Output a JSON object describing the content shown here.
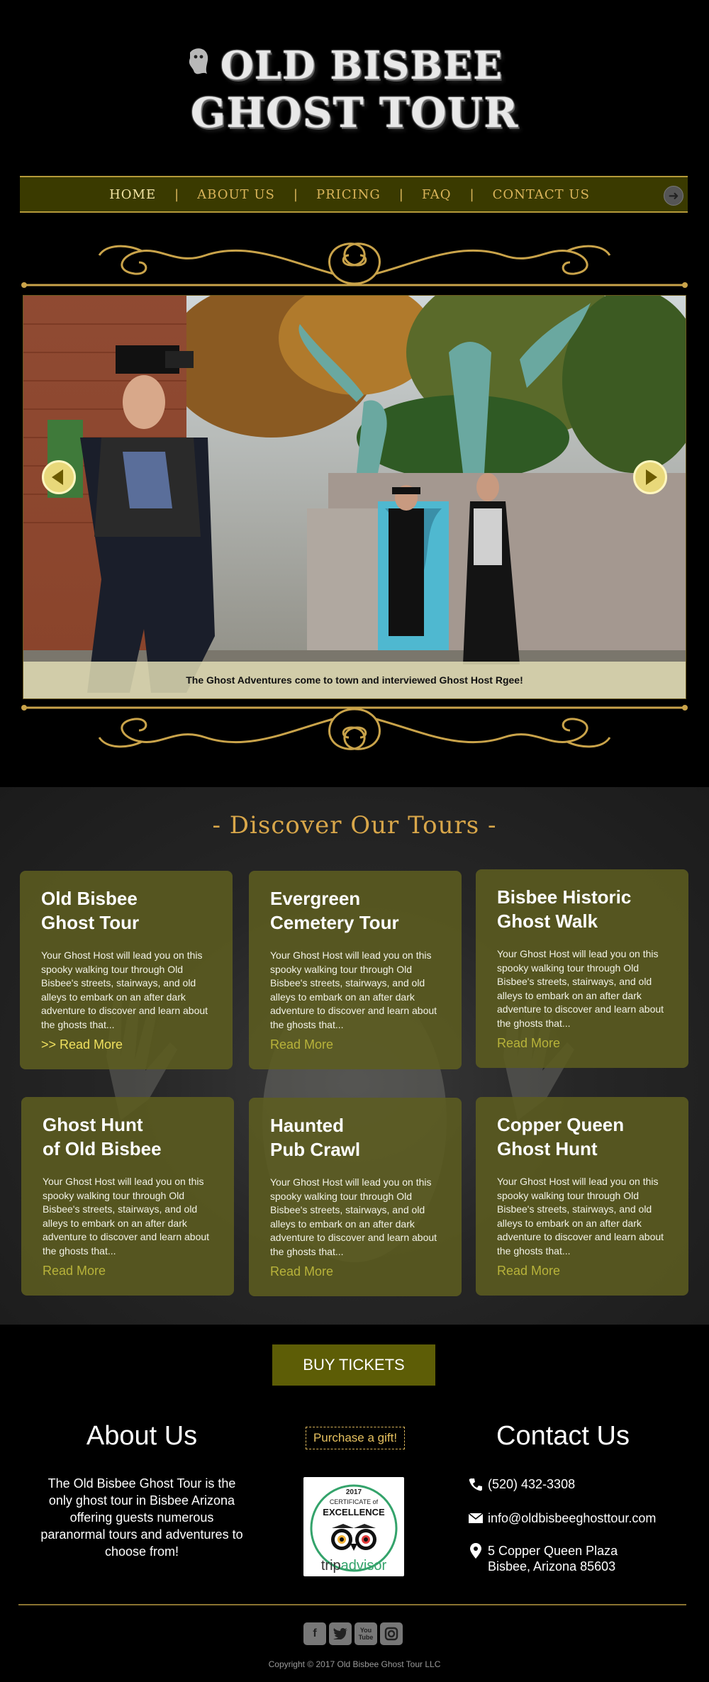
{
  "header": {
    "logo_line1": "OLD BISBEE",
    "logo_line2": "GHOST TOUR"
  },
  "nav": {
    "items": [
      {
        "label": "HOME",
        "active": true
      },
      {
        "label": "ABOUT US"
      },
      {
        "label": "PRICING"
      },
      {
        "label": "FAQ"
      },
      {
        "label": "CONTACT US"
      }
    ],
    "separator": "|"
  },
  "slider": {
    "caption": "The Ghost Adventures come to town and interviewed Ghost Host Rgee!"
  },
  "tours": {
    "title": "- Discover Our Tours -",
    "cards": [
      {
        "title": "Old Bisbee\nGhost Tour",
        "description": "Your Ghost Host will lead you on this spooky walking tour through Old Bisbee's streets, stairways, and old alleys to embark on an after dark adventure to discover and learn about the ghosts that...",
        "more": ">> Read More"
      },
      {
        "title": "Evergreen\nCemetery Tour",
        "description": "Your Ghost Host will lead you on this spooky walking tour through Old Bisbee's streets, stairways, and old alleys to embark on an after dark adventure to discover and learn about the ghosts that...",
        "more": "Read More"
      },
      {
        "title": "Bisbee Historic\nGhost Walk",
        "description": "Your Ghost Host will lead you on this spooky walking tour through Old Bisbee's streets, stairways, and old alleys to embark on an after dark adventure to discover and learn about the ghosts that...",
        "more": "Read More"
      },
      {
        "title": "Ghost Hunt\nof Old Bisbee",
        "description": "Your Ghost Host will lead you on this spooky walking tour through Old Bisbee's streets, stairways, and old alleys to embark on an after dark adventure to discover and learn about the ghosts that...",
        "more": "Read More"
      },
      {
        "title": "Haunted\nPub Crawl",
        "description": "Your Ghost Host will lead you on this spooky walking tour through Old Bisbee's streets, stairways, and old alleys to embark on an after dark adventure to discover and learn about the ghosts that...",
        "more": "Read More"
      },
      {
        "title": "Copper Queen\nGhost Hunt",
        "description": "Your Ghost Host will lead you on this spooky walking tour through Old Bisbee's streets, stairways, and old alleys to embark on an after dark adventure to discover and learn about the ghosts that...",
        "more": "Read More"
      }
    ]
  },
  "buy_tickets": "BUY TICKETS",
  "about": {
    "heading": "About Us",
    "text": "The Old Bisbee Ghost Tour is  the only ghost tour in Bisbee Arizona offering guests numerous paranormal tours and adventures to choose from!"
  },
  "gift": "Purchase a gift!",
  "tripadvisor": {
    "year": "2017",
    "line1": "CERTIFICATE of",
    "line2": "EXCELLENCE",
    "brand_a": "trip",
    "brand_b": "advisor"
  },
  "contact": {
    "heading": "Contact Us",
    "phone": "(520) 432-3308",
    "email": "info@oldbisbeeghosttour.com",
    "address_line1": "5 Copper Queen Plaza",
    "address_line2": "Bisbee, Arizona 85603"
  },
  "social": [
    "facebook-icon",
    "twitter-icon",
    "youtube-icon",
    "instagram-icon"
  ],
  "copyright": "Copyright © 2017 Old Bisbee Ghost Tour LLC",
  "colors": {
    "gold": "#d9b45a",
    "nav_bg": "#3a3a00",
    "card_bg": "#5c5c20",
    "button_bg": "#5d5d06",
    "read_more": "#b8b33a"
  }
}
